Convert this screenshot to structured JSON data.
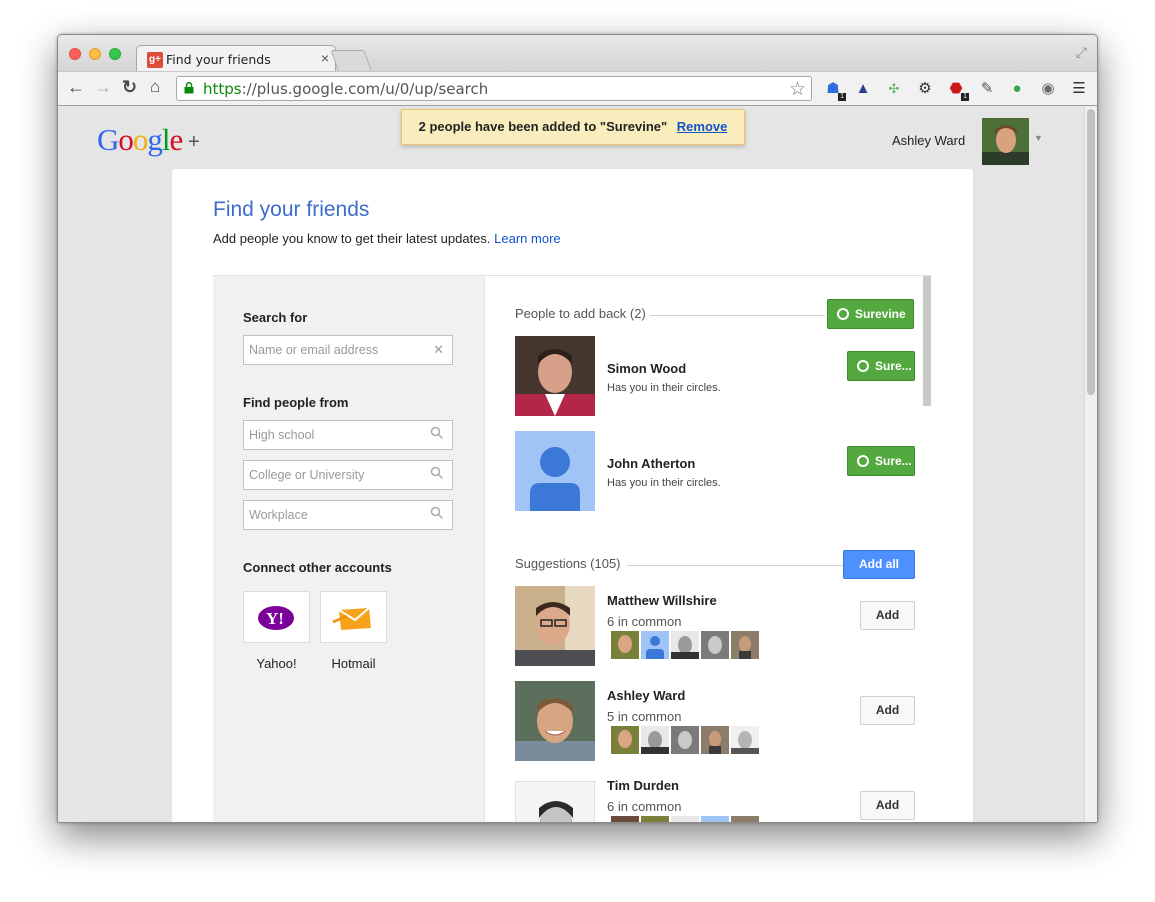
{
  "browser": {
    "tab_title": "Find your friends",
    "tab_close": "×",
    "url_scheme": "https",
    "url_rest": "://plus.google.com/u/0/up/search",
    "star_icon": "☆",
    "extension_badges": [
      "1",
      "1"
    ]
  },
  "header": {
    "logo_letters": [
      {
        "char": "G",
        "color": "#3369e8"
      },
      {
        "char": "o",
        "color": "#d50f25"
      },
      {
        "char": "o",
        "color": "#eeb211"
      },
      {
        "char": "g",
        "color": "#3369e8"
      },
      {
        "char": "l",
        "color": "#009925"
      },
      {
        "char": "e",
        "color": "#d50f25"
      }
    ],
    "logo_plus": "+",
    "notice_text": "2 people have been added to \"Surevine\"",
    "notice_action": "Remove",
    "user_name": "Ashley Ward"
  },
  "page": {
    "title": "Find your friends",
    "subtitle": "Add people you know to get their latest updates.",
    "learn_more": "Learn more"
  },
  "left_panel": {
    "search_heading": "Search for",
    "search_placeholder": "Name or email address",
    "clear_icon": "✕",
    "find_heading": "Find people from",
    "find_fields": [
      "High school",
      "College or University",
      "Workplace"
    ],
    "connect_heading": "Connect other accounts",
    "accounts": [
      {
        "label": "Yahoo!",
        "icon": "yahoo-icon",
        "icon_text": "Y!",
        "color": "#7b0099"
      },
      {
        "label": "Hotmail",
        "icon": "hotmail-icon",
        "color": "#f38b00"
      }
    ]
  },
  "add_back": {
    "title": "People to add back (2)",
    "circle_button": "Surevine",
    "people": [
      {
        "name": "Simon Wood",
        "sub": "Has you in their circles.",
        "button": "Sure..."
      },
      {
        "name": "John Atherton",
        "sub": "Has you in their circles.",
        "button": "Sure..."
      }
    ]
  },
  "suggestions": {
    "title": "Suggestions (105)",
    "add_all": "Add all",
    "people": [
      {
        "name": "Matthew Willshire",
        "common": "6 in common",
        "button": "Add"
      },
      {
        "name": "Ashley Ward",
        "common": "5 in common",
        "button": "Add"
      },
      {
        "name": "Tim Durden",
        "common": "6 in common",
        "button": "Add"
      }
    ]
  },
  "colors": {
    "accent_blue": "#4d90fe",
    "circle_green": "#53a93f",
    "notice_bg": "#f9edbe",
    "title_blue": "#3d6dcc"
  }
}
